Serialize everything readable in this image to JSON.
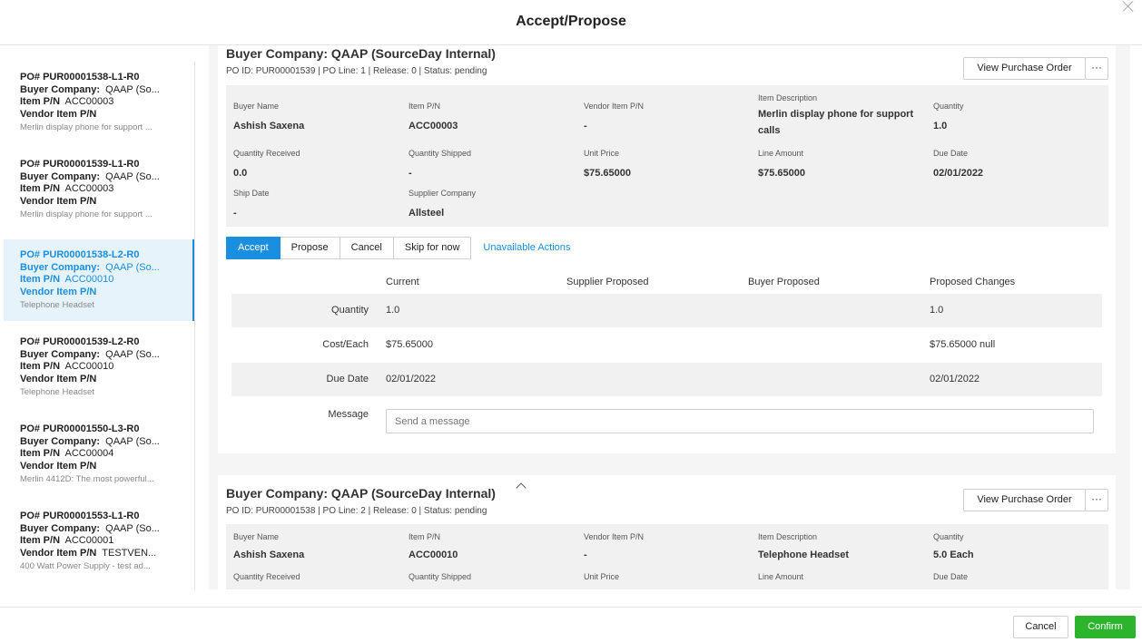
{
  "modal": {
    "title": "Accept/Propose"
  },
  "sidebar": {
    "items": [
      {
        "po": "PO# PUR00001538-L1-R0",
        "buyer_label": "Buyer Company:",
        "buyer_value": "QAAP (So...",
        "item_label": "Item P/N",
        "item_value": "ACC00003",
        "vendor_label": "Vendor Item P/N",
        "vendor_value": "",
        "desc": "Merlin display phone for support ..."
      },
      {
        "po": "PO# PUR00001539-L1-R0",
        "buyer_label": "Buyer Company:",
        "buyer_value": "QAAP (So...",
        "item_label": "Item P/N",
        "item_value": "ACC00003",
        "vendor_label": "Vendor Item P/N",
        "vendor_value": "",
        "desc": "Merlin display phone for support ..."
      },
      {
        "po": "PO# PUR00001538-L2-R0",
        "buyer_label": "Buyer Company:",
        "buyer_value": "QAAP (So...",
        "item_label": "Item P/N",
        "item_value": "ACC00010",
        "vendor_label": "Vendor Item P/N",
        "vendor_value": "",
        "desc": "Telephone Headset"
      },
      {
        "po": "PO# PUR00001539-L2-R0",
        "buyer_label": "Buyer Company:",
        "buyer_value": "QAAP (So...",
        "item_label": "Item P/N",
        "item_value": "ACC00010",
        "vendor_label": "Vendor Item P/N",
        "vendor_value": "",
        "desc": "Telephone Headset"
      },
      {
        "po": "PO# PUR00001550-L3-R0",
        "buyer_label": "Buyer Company:",
        "buyer_value": "QAAP (So...",
        "item_label": "Item P/N",
        "item_value": "ACC00004",
        "vendor_label": "Vendor Item P/N",
        "vendor_value": "",
        "desc": "Merlin 4412D: The most powerful..."
      },
      {
        "po": "PO# PUR00001553-L1-R0",
        "buyer_label": "Buyer Company:",
        "buyer_value": "QAAP (So...",
        "item_label": "Item P/N",
        "item_value": "ACC00001",
        "vendor_label": "Vendor Item P/N",
        "vendor_value": "TESTVEN...",
        "desc": "400 Watt Power Supply - test ad..."
      }
    ]
  },
  "card1": {
    "title": "Buyer Company: QAAP (SourceDay Internal)",
    "subtitle": "PO ID: PUR00001539 | PO Line: 1 | Release: 0 | Status: pending",
    "view_po": "View Purchase Order",
    "more": "···",
    "fields": {
      "buyer_name_l": "Buyer Name",
      "buyer_name_v": "Ashish Saxena",
      "item_pn_l": "Item P/N",
      "item_pn_v": "ACC00003",
      "vendor_pn_l": "Vendor Item P/N",
      "vendor_pn_v": "-",
      "desc_l": "Item Description",
      "desc_v": "Merlin display phone for support calls",
      "qty_l": "Quantity",
      "qty_v": "1.0",
      "qty_recv_l": "Quantity Received",
      "qty_recv_v": "0.0",
      "qty_ship_l": "Quantity Shipped",
      "qty_ship_v": "-",
      "unit_price_l": "Unit Price",
      "unit_price_v": "$75.65000",
      "line_amt_l": "Line Amount",
      "line_amt_v": "$75.65000",
      "due_l": "Due Date",
      "due_v": "02/01/2022",
      "ship_l": "Ship Date",
      "ship_v": "-",
      "supplier_l": "Supplier Company",
      "supplier_v": "Allsteel"
    },
    "actions": {
      "accept": "Accept",
      "propose": "Propose",
      "cancel": "Cancel",
      "skip": "Skip for now",
      "unavailable": "Unavailable Actions"
    },
    "compare": {
      "headers": {
        "current": "Current",
        "supplier": "Supplier Proposed",
        "buyer": "Buyer Proposed",
        "changes": "Proposed Changes"
      },
      "rows": [
        {
          "label": "Quantity",
          "current": "1.0",
          "changes": "1.0"
        },
        {
          "label": "Cost/Each",
          "current": "$75.65000",
          "changes": "$75.65000 null"
        },
        {
          "label": "Due Date",
          "current": "02/01/2022",
          "changes": "02/01/2022"
        }
      ],
      "message_label": "Message",
      "message_placeholder": "Send a message"
    }
  },
  "card2": {
    "title": "Buyer Company: QAAP (SourceDay Internal)",
    "subtitle": "PO ID: PUR00001538 | PO Line: 2 | Release: 0 | Status: pending",
    "view_po": "View Purchase Order",
    "more": "···",
    "fields": {
      "buyer_name_l": "Buyer Name",
      "buyer_name_v": "Ashish Saxena",
      "item_pn_l": "Item P/N",
      "item_pn_v": "ACC00010",
      "vendor_pn_l": "Vendor Item P/N",
      "vendor_pn_v": "-",
      "desc_l": "Item Description",
      "desc_v": "Telephone Headset",
      "qty_l": "Quantity",
      "qty_v": "5.0 Each",
      "qty_recv_l": "Quantity Received",
      "qty_ship_l": "Quantity Shipped",
      "unit_price_l": "Unit Price",
      "line_amt_l": "Line Amount",
      "due_l": "Due Date"
    }
  },
  "footer": {
    "cancel": "Cancel",
    "confirm": "Confirm"
  },
  "colors": {
    "accent": "#1a8fe0",
    "confirm": "#2cb52c"
  }
}
